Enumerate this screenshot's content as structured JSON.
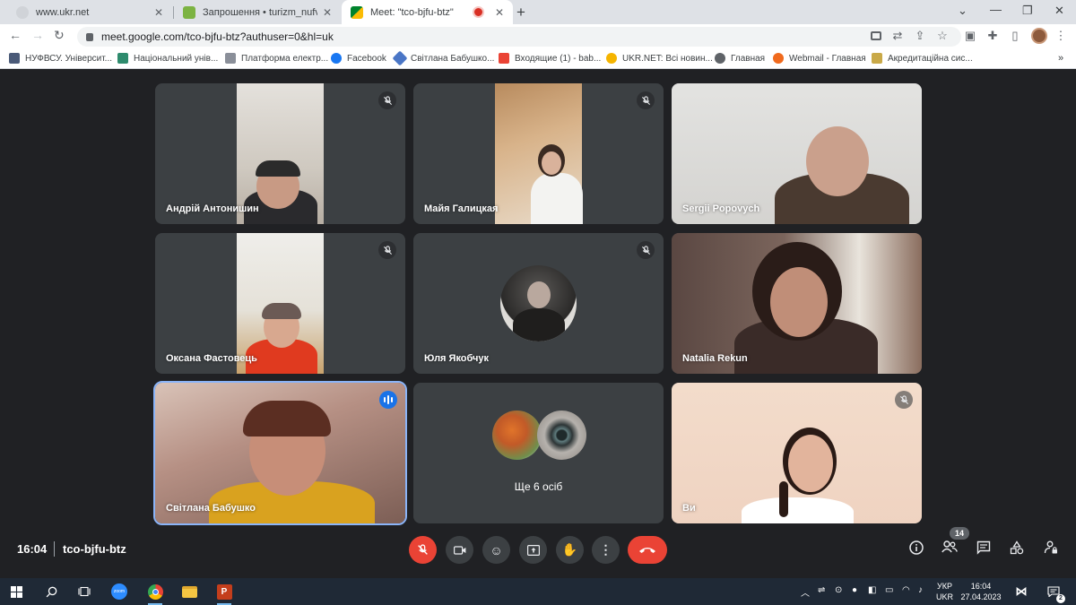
{
  "browser": {
    "tabs": [
      {
        "title": "www.ukr.net",
        "active": false
      },
      {
        "title": "Запрошення • turizm_nufvsu@u",
        "active": false
      },
      {
        "title": "Meet: \"tco-bjfu-btz\"",
        "active": true
      }
    ],
    "url": "meet.google.com/tco-bjfu-btz?authuser=0&hl=uk"
  },
  "bookmarks": [
    "НУФВСУ. Університ...",
    "Національний унів...",
    "Платформа електр...",
    "Facebook",
    "Світлана Бабушко...",
    "Входящие (1) - bab...",
    "UKR.NET: Всі новин...",
    "Главная",
    "Webmail - Главная",
    "Акредитаційна сис..."
  ],
  "tiles": [
    {
      "name": "Андрій Антонишин",
      "muted": true
    },
    {
      "name": "Майя Галицкая",
      "muted": true
    },
    {
      "name": "Sergii Popovych",
      "muted": false
    },
    {
      "name": "Оксана Фастовець",
      "muted": true
    },
    {
      "name": "Юля Якобчук",
      "muted": true
    },
    {
      "name": "Natalia Rekun",
      "muted": false
    },
    {
      "name": "Світлана Бабушко",
      "speaking": true
    },
    {
      "name": "Ще 6 осіб",
      "group": true
    },
    {
      "name": "Ви",
      "muted": true
    }
  ],
  "meeting": {
    "time": "16:04",
    "code": "tco-bjfu-btz",
    "participants_count": "14"
  },
  "taskbar": {
    "lang_top": "УКР",
    "lang_bottom": "UKR",
    "time": "16:04",
    "date": "27.04.2023",
    "notifications": "2"
  },
  "colors": {
    "meet_bg": "#202124",
    "tile_bg": "#3c4043",
    "end_call": "#ea4335",
    "speaking": "#1a73e8"
  }
}
